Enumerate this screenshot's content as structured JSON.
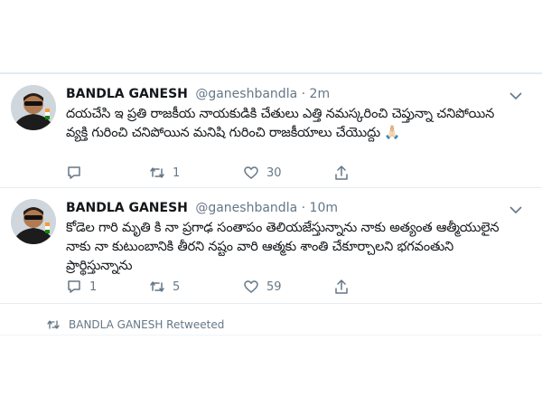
{
  "tweets": [
    {
      "author_name": "BANDLA GANESH",
      "handle": "@ganeshbandla",
      "separator": "·",
      "time": "2m",
      "text": "దయచేసి ఇ ప్రతి రాజకీయ నాయకుడికి చేతులు ఎత్తి నమస్కరించి చెప్తున్నా చనిపోయిన వ్యక్తి గురించి చనిపోయిన మనిషి గురించి రాజకీయాలు చేయొద్దు 🙏🏻",
      "reply_count": "",
      "retweet_count": "1",
      "like_count": "30"
    },
    {
      "author_name": "BANDLA GANESH",
      "handle": "@ganeshbandla",
      "separator": "·",
      "time": "10m",
      "text": "కోడెల గారి మృతి కి నా ప్రగాఢ సంతాపం తెలియజేస్తున్నాను నాకు అత్యంత ఆత్మీయులైన నాకు నా కుటుంబానికి తీరని నష్టం వారి ఆత్మకు శాంతి చేకూర్చాలని భగవంతుని ప్రార్థిస్తున్నాను",
      "reply_count": "1",
      "retweet_count": "5",
      "like_count": "59"
    }
  ],
  "retweet_context": "BANDLA GANESH Retweeted",
  "colors": {
    "text_primary": "#14171a",
    "text_secondary": "#657786",
    "divider": "#e6ecf0"
  },
  "icons": {
    "reply": "reply-icon",
    "retweet": "retweet-icon",
    "like": "heart-icon",
    "share": "share-icon",
    "menu": "chevron-down-icon"
  }
}
